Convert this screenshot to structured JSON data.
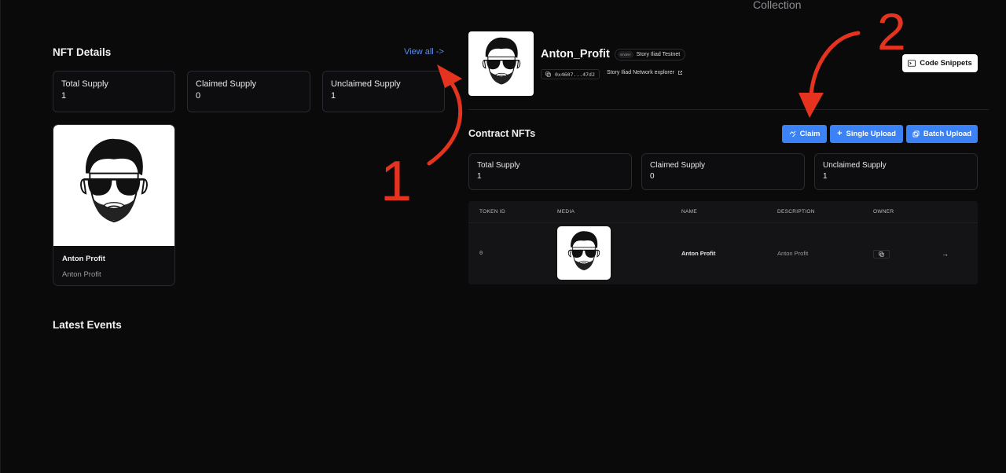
{
  "page": {
    "top_heading": "Collection"
  },
  "nft_details": {
    "title": "NFT Details",
    "view_all": "View all ->",
    "stats": [
      {
        "label": "Total Supply",
        "value": "1"
      },
      {
        "label": "Claimed Supply",
        "value": "0"
      },
      {
        "label": "Unclaimed Supply",
        "value": "1"
      }
    ],
    "card": {
      "name": "Anton Profit",
      "description": "Anton Profit"
    }
  },
  "latest_events": {
    "title": "Latest Events"
  },
  "contract": {
    "name": "Anton_Profit",
    "chain_logo_text": "STORY",
    "chain": "Story Iliad Testnet",
    "address": "0x4607...47d2",
    "explorer_link": "Story Iliad Network explorer",
    "code_snippets": "Code Snippets"
  },
  "contract_nfts": {
    "title": "Contract NFTs",
    "buttons": {
      "claim": "Claim",
      "single_upload": "Single Upload",
      "batch_upload": "Batch Upload"
    },
    "stats": [
      {
        "label": "Total Supply",
        "value": "1"
      },
      {
        "label": "Claimed Supply",
        "value": "0"
      },
      {
        "label": "Unclaimed Supply",
        "value": "1"
      }
    ],
    "table": {
      "columns": [
        "TOKEN ID",
        "MEDIA",
        "NAME",
        "DESCRIPTION",
        "OWNER"
      ],
      "rows": [
        {
          "token_id": "0",
          "name": "Anton Profit",
          "description": "Anton Profit"
        }
      ]
    }
  },
  "annotations": {
    "one": "1",
    "two": "2",
    "color": "#e5331f"
  },
  "colors": {
    "accent": "#3b82f6",
    "link": "#5b8def",
    "background": "#0a0a0b"
  }
}
